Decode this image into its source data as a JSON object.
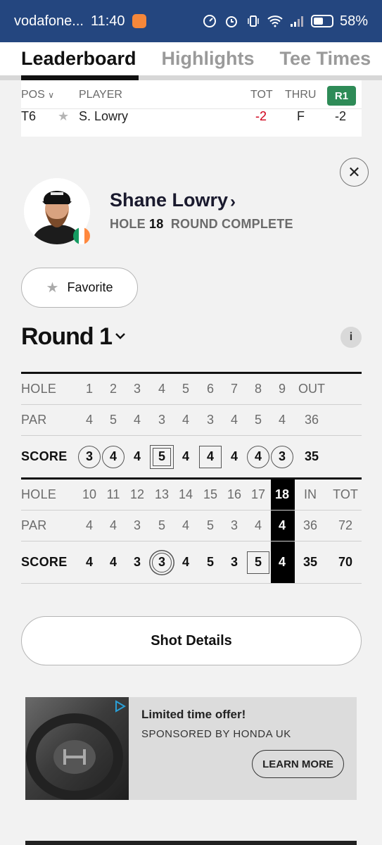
{
  "status_bar": {
    "carrier": "vodafone...",
    "time": "11:40",
    "battery": "58%"
  },
  "tabs": [
    {
      "label": "Leaderboard",
      "active": true
    },
    {
      "label": "Highlights",
      "active": false
    },
    {
      "label": "Tee Times",
      "active": false
    }
  ],
  "leaderboard": {
    "headers": {
      "pos": "POS",
      "player": "PLAYER",
      "tot": "TOT",
      "thru": "THRU",
      "round": "R1"
    },
    "row": {
      "pos": "T6",
      "player": "S. Lowry",
      "tot": "-2",
      "thru": "F",
      "round": "-2"
    }
  },
  "player": {
    "name": "Shane Lowry",
    "hole_label": "HOLE",
    "hole": "18",
    "status": "ROUND COMPLETE",
    "flag_colors": [
      "#169b62",
      "#ffffff",
      "#ff883e"
    ]
  },
  "favorite_label": "Favorite",
  "round_label": "Round 1",
  "info_label": "i",
  "scorecard": {
    "front": {
      "hole_label": "HOLE",
      "holes": [
        "1",
        "2",
        "3",
        "4",
        "5",
        "6",
        "7",
        "8",
        "9"
      ],
      "total_label": "OUT",
      "par_label": "PAR",
      "par": [
        "4",
        "5",
        "4",
        "3",
        "4",
        "3",
        "4",
        "5",
        "4"
      ],
      "par_total": "36",
      "score_label": "SCORE",
      "scores": [
        "3",
        "4",
        "4",
        "5",
        "4",
        "4",
        "4",
        "4",
        "3"
      ],
      "score_marks": [
        "circle",
        "circle",
        "none",
        "dsquare",
        "none",
        "square",
        "none",
        "circle",
        "circle"
      ],
      "score_total": "35"
    },
    "back": {
      "hole_label": "HOLE",
      "holes": [
        "10",
        "11",
        "12",
        "13",
        "14",
        "15",
        "16",
        "17",
        "18"
      ],
      "in_label": "IN",
      "tot_label": "TOT",
      "par_label": "PAR",
      "par": [
        "4",
        "4",
        "3",
        "5",
        "4",
        "5",
        "3",
        "4",
        "4"
      ],
      "par_in": "36",
      "par_tot": "72",
      "score_label": "SCORE",
      "scores": [
        "4",
        "4",
        "3",
        "3",
        "4",
        "5",
        "3",
        "5",
        "4"
      ],
      "score_marks": [
        "none",
        "none",
        "none",
        "dcircle",
        "none",
        "none",
        "none",
        "square",
        "none"
      ],
      "score_in": "35",
      "score_tot": "70",
      "highlight_hole": "18"
    }
  },
  "shot_details_label": "Shot Details",
  "ad": {
    "title": "Limited time offer!",
    "sponsor": "SPONSORED BY HONDA UK",
    "cta": "LEARN MORE"
  }
}
